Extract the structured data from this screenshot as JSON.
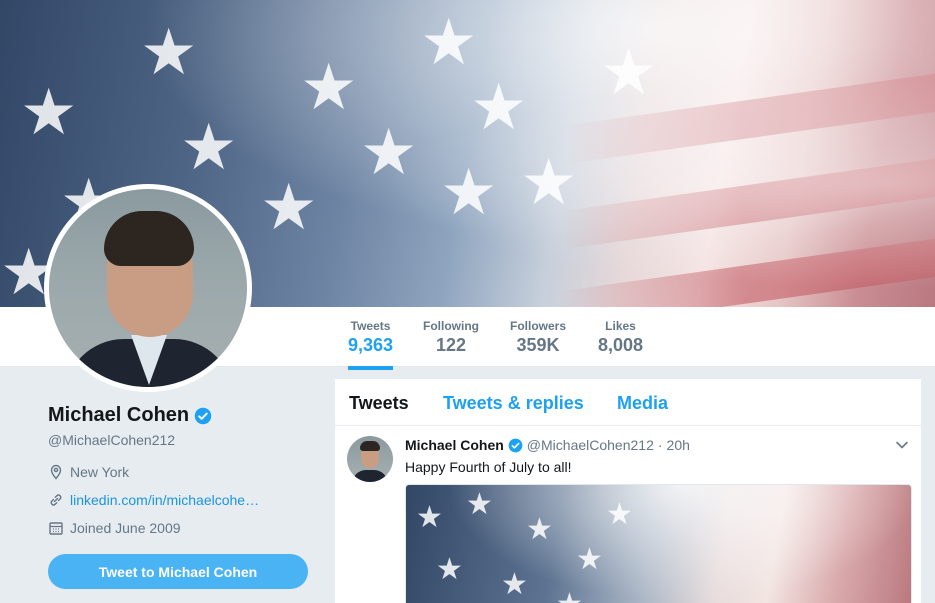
{
  "profile": {
    "name": "Michael Cohen",
    "handle": "@MichaelCohen212",
    "location": "New York",
    "website": "linkedin.com/in/michaelcohe…",
    "joined": "Joined June 2009",
    "tweet_to_label": "Tweet to Michael Cohen"
  },
  "stats": [
    {
      "label": "Tweets",
      "value": "9,363"
    },
    {
      "label": "Following",
      "value": "122"
    },
    {
      "label": "Followers",
      "value": "359K"
    },
    {
      "label": "Likes",
      "value": "8,008"
    }
  ],
  "tabs": [
    "Tweets",
    "Tweets & replies",
    "Media"
  ],
  "tweet": {
    "name": "Michael Cohen",
    "handle": "@MichaelCohen212",
    "separator": "·",
    "time": "20h",
    "text": "Happy Fourth of July to all!"
  },
  "icons": {
    "verified": "verified-badge-icon",
    "location": "location-pin-icon",
    "link": "link-icon",
    "calendar": "calendar-icon",
    "chevron": "chevron-down-icon"
  },
  "colors": {
    "accent": "#1da1f2",
    "button": "#4ab3f4",
    "link": "#1b95e0",
    "muted": "#657786"
  }
}
